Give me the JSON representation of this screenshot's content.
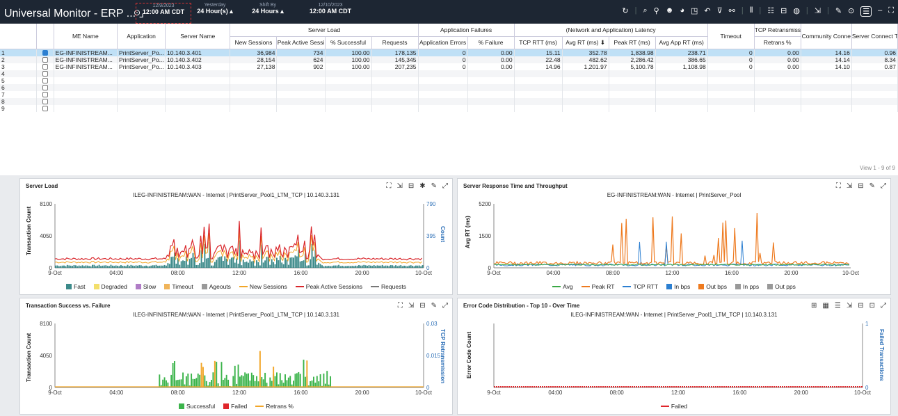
{
  "topbar": {
    "title": "Universal Monitor - ERP ... ⌟",
    "time1": {
      "small": "12/9/2023",
      "big": "12:00 AM CDT"
    },
    "time2": {
      "small": "Yesterday",
      "big": "24 Hour(s) ▴"
    },
    "time3": {
      "small": "Shift By",
      "big": "24 Hours ▴"
    },
    "time4": {
      "small": "12/10/2023",
      "big": "12:00 AM CDT"
    },
    "icons": [
      "refresh-icon",
      "search-icon",
      "drill-icon",
      "user-icon",
      "pie-icon",
      "filter-icon",
      "undo-icon",
      "funnel-icon",
      "link-icon",
      "bar-icon",
      "columns-icon",
      "layout-icon",
      "globe-icon",
      "export-icon",
      "edit-icon",
      "toggle-icon",
      "menu-icon",
      "minimize-icon",
      "expand-icon"
    ]
  },
  "table": {
    "group_headers": {
      "server_load": "Server Load",
      "app_failures": "Application Failures",
      "latency": "(Network and Application) Latency",
      "tcp": "TCP Retransmissi"
    },
    "columns": {
      "me_name": "ME Name",
      "application": "Application",
      "server_name": "Server Name",
      "new_sessions": "New Sessions",
      "peak_active": "Peak Active Sessi",
      "pct_successful": "% Successful",
      "requests": "Requests",
      "app_errors": "Application Errors",
      "pct_failure": "% Failure",
      "tcp_rtt": "TCP RTT (ms)",
      "avg_rt": "Avg RT (ms) ⬇",
      "peak_rt": "Peak RT (ms)",
      "avg_app_rt": "Avg App RT (ms)",
      "timeout": "Timeout",
      "retrans": "Retrans %",
      "community": "Community Conne",
      "server_connect": "Server Connect T"
    },
    "rows": [
      {
        "n": "1",
        "me": "EG-INFINISTREAM...",
        "app": "PrintServer_Po...",
        "server": "10.140.3.401",
        "new": "36,984",
        "peak": "734",
        "succ": "100.00",
        "req": "178,135",
        "err": "0",
        "fail": "0.00",
        "rtt": "15.11",
        "avg": "352.78",
        "peakrt": "1,838.98",
        "apprt": "238.71",
        "timeout": "0",
        "retr": "0.00",
        "comm": "14.16",
        "conn": "0.96"
      },
      {
        "n": "2",
        "me": "EG-INFINISTREAM...",
        "app": "PrintServer_Po...",
        "server": "10.140.3.402",
        "new": "28,154",
        "peak": "624",
        "succ": "100.00",
        "req": "145,345",
        "err": "0",
        "fail": "0.00",
        "rtt": "22.48",
        "avg": "482.62",
        "peakrt": "2,286.42",
        "apprt": "386.65",
        "timeout": "0",
        "retr": "0.00",
        "comm": "14.14",
        "conn": "8.34"
      },
      {
        "n": "3",
        "me": "EG-INFINISTREAM...",
        "app": "PrintServer_Po...",
        "server": "10.140.3.403",
        "new": "27,138",
        "peak": "902",
        "succ": "100.00",
        "req": "207,235",
        "err": "0",
        "fail": "0.00",
        "rtt": "14.96",
        "avg": "1,201.97",
        "peakrt": "5,100.78",
        "apprt": "1,108.98",
        "timeout": "0",
        "retr": "0.00",
        "comm": "14.10",
        "conn": "0.87"
      }
    ],
    "empty_rows": [
      "4",
      "5",
      "6",
      "7",
      "8",
      "9"
    ],
    "pager": "View 1 - 9 of 9"
  },
  "panels": {
    "server_load": {
      "title": "Server Load",
      "subtitle": "ILEG-INFINISTREAM:WAN - Internet | PrintServer_Pool1_LTM_TCP | 10.140.3.131",
      "ylabel": "Transaction Count",
      "ylabel_r": "Count",
      "yticks": [
        "8100",
        "4050",
        "0"
      ],
      "yticks_r": [
        "790",
        "395",
        "0"
      ],
      "xticks": [
        "9-Oct",
        "04:00",
        "08:00",
        "12:00",
        "16:00",
        "20:00",
        "10-Oct"
      ],
      "legend": [
        "Fast",
        "Degraded",
        "Slow",
        "Timeout",
        "Ageouts",
        "New Sessions",
        "Peak Active Sessions",
        "Requests"
      ]
    },
    "response": {
      "title": "Server Response Time and Throughput",
      "subtitle": "EG-INFINISTREAM:WAN - Internet | PrintServer_Pool",
      "ylabel": "Avg RT (ms)",
      "yticks": [
        "5200",
        "1500",
        "0"
      ],
      "xticks": [
        "9-Oct",
        "04:00",
        "08:00",
        "12:00",
        "16:00",
        "20:00",
        "10-Oct"
      ],
      "legend": [
        "Avg",
        "Peak RT",
        "TCP RTT",
        "In bps",
        "Out bps",
        "In pps",
        "Out pps"
      ]
    },
    "success": {
      "title": "Transaction Success vs. Failure",
      "subtitle": "ILEG-INFINISTREAM:WAN - Internet | PrintServer_Pool1_LTM_TCP | 10.140.3.131",
      "ylabel": "Transaction Count",
      "ylabel_r": "TCP Retransmission",
      "yticks": [
        "8100",
        "4050",
        "0"
      ],
      "yticks_r": [
        "0.03",
        "0.015",
        "0"
      ],
      "xticks": [
        "9-Oct",
        "04:00",
        "08:00",
        "12:00",
        "16:00",
        "20:00",
        "10-Oct"
      ],
      "legend": [
        "Successful",
        "Failed",
        "Retrans %"
      ]
    },
    "errors": {
      "title": "Error Code Distribution - Top 10 - Over Time",
      "subtitle": "ILEG-INFINISTREAM:WAN - Internet | PrintServer_Pool1_LTM_TCP | 10.140.3.131",
      "ylabel": "Error Code Count",
      "ylabel_r": "Failed Transactions",
      "yticks_r": [
        "1",
        "0"
      ],
      "xticks": [
        "9-Oct",
        "04:00",
        "08:00",
        "12:00",
        "16:00",
        "20:00",
        "10-Oct"
      ],
      "legend": [
        "Failed"
      ]
    }
  },
  "colors": {
    "fast": "#3c8a8a",
    "degraded": "#f3df6b",
    "slow": "#b07cc6",
    "timeout": "#f0b45a",
    "ageouts": "#999999",
    "new_sessions": "#f2a628",
    "peak_sessions": "#d9262b",
    "requests": "#777777",
    "avg": "#3aa845",
    "peak_rt": "#ee7a1f",
    "tcp_rtt": "#2c7fd1",
    "successful": "#3cb44b",
    "failed": "#e0262b"
  }
}
